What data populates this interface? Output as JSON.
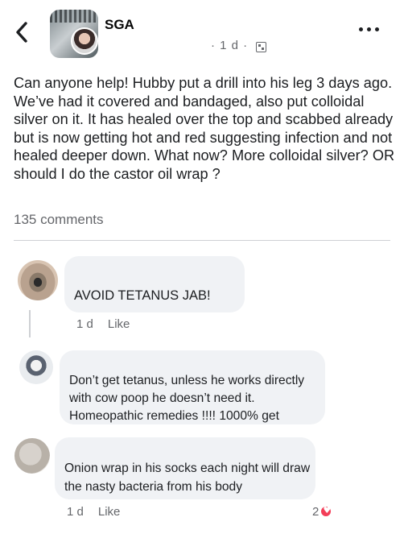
{
  "header": {
    "group_name": "SGA",
    "post_age": "· 1 d ·",
    "back_icon": "chevron-left-icon",
    "more_icon": "more-horizontal-icon",
    "audience_icon": "group-audience-icon"
  },
  "post": {
    "text": "Can anyone help! Hubby put a drill into his leg 3 days ago. We’ve had it covered and bandaged, also put colloidal silver on it. It has healed over the top and scabbed already but is now getting hot and red suggesting infection and not healed deeper down. What now? More colloidal silver? OR should I do the castor oil wrap ?",
    "comments_count": "135 comments"
  },
  "comments": [
    {
      "text": "AVOID TETANUS JAB!",
      "age": "1 d",
      "like_label": "Like"
    },
    {
      "text": "Don’t get tetanus, unless he works directly with cow poop he doesn’t need it. Homeopathic remedies !!!! 1000% get"
    },
    {
      "text": "Onion wrap in his socks each night will draw the nasty bacteria from his body",
      "age": "1 d",
      "like_label": "Like",
      "reaction_count": "2"
    }
  ],
  "colors": {
    "text_primary": "#1c1e21",
    "text_secondary": "#65676b",
    "bubble_bg": "#f0f2f5",
    "heart_reaction": "#f33e58"
  }
}
